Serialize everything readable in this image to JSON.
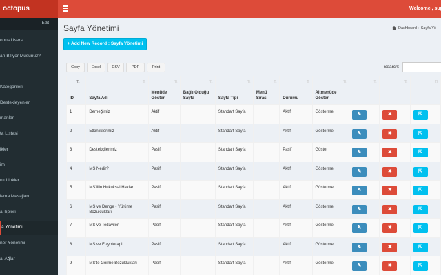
{
  "app": {
    "logo": "octopus",
    "welcome": "Welcome , super"
  },
  "sidebar": {
    "edit_label": "Edit",
    "items": [
      {
        "label": "opus Users"
      },
      {
        "label": "arı Biliyor Musunuz?"
      },
      {
        "label": "Kategorileri"
      },
      {
        "label": "Destekleyenler"
      },
      {
        "label": "manlar"
      },
      {
        "label": "ta Listesi"
      },
      {
        "label": "ikler"
      },
      {
        "label": "im"
      },
      {
        "label": "nlı Linkler"
      },
      {
        "label": "lama Mesajları"
      },
      {
        "label": "a Tipleri"
      },
      {
        "label": "a Yönetimi"
      },
      {
        "label": "ner Yönetimi"
      },
      {
        "label": "al Ağlar"
      }
    ]
  },
  "page": {
    "title": "Sayfa Yönetimi",
    "breadcrumb": {
      "home": "Dashboard",
      "current": "Sayfa Yö"
    },
    "add_button": "+ Add New Record : Sayfa Yönetimi"
  },
  "toolbar": {
    "buttons": [
      "Copy",
      "Excel",
      "CSV",
      "PDF",
      "Print"
    ],
    "search_label": "Search:",
    "search_value": ""
  },
  "table": {
    "headers": [
      "ID",
      "Sayfa Adı",
      "Menüde Göster",
      "Bağlı Olduğu Sayfa",
      "Sayfa Tipi",
      "Menü Sırası",
      "Durumu",
      "Altmenüde Göster",
      "",
      "",
      ""
    ],
    "rows": [
      {
        "id": "1",
        "name": "Derneğimiz",
        "menu": "Aktif",
        "parent": "",
        "type": "Standart Sayfa",
        "order": "",
        "status": "Aktif",
        "submenu": "Gösterme"
      },
      {
        "id": "2",
        "name": "Etkinliklerimiz",
        "menu": "Aktif",
        "parent": "",
        "type": "Standart Sayfa",
        "order": "",
        "status": "Aktif",
        "submenu": "Gösterme"
      },
      {
        "id": "3",
        "name": "Destekçilerimiz",
        "menu": "Pasif",
        "parent": "",
        "type": "Standart Sayfa",
        "order": "",
        "status": "Pasif",
        "submenu": "Göster"
      },
      {
        "id": "4",
        "name": "MS Nedir?",
        "menu": "Pasif",
        "parent": "",
        "type": "Standart Sayfa",
        "order": "",
        "status": "Aktif",
        "submenu": "Gösterme"
      },
      {
        "id": "5",
        "name": "MS'lilin Hukuksal Hakları",
        "menu": "Pasif",
        "parent": "",
        "type": "Standart Sayfa",
        "order": "",
        "status": "Aktif",
        "submenu": "Gösterme"
      },
      {
        "id": "6",
        "name": "MS ve Denge - Yürüme Bozuklukları",
        "menu": "Pasif",
        "parent": "",
        "type": "Standart Sayfa",
        "order": "",
        "status": "Aktif",
        "submenu": "Gösterme"
      },
      {
        "id": "7",
        "name": "MS ve Tedaviler",
        "menu": "Pasif",
        "parent": "",
        "type": "Standart Sayfa",
        "order": "",
        "status": "Aktif",
        "submenu": "Gösterme"
      },
      {
        "id": "8",
        "name": "MS ve Fizyoterapi",
        "menu": "Pasif",
        "parent": "",
        "type": "Standart Sayfa",
        "order": "",
        "status": "Aktif",
        "submenu": "Gösterme"
      },
      {
        "id": "9",
        "name": "MS'te Görme Bozuklukları",
        "menu": "Pasif",
        "parent": "",
        "type": "Standart Sayfa",
        "order": "",
        "status": "Aktif",
        "submenu": "Gösterme"
      }
    ]
  },
  "icons": {
    "edit": "edit-icon",
    "delete": "delete-icon",
    "open": "external-link-icon",
    "menu": "hamburger-icon",
    "home": "dashboard-icon"
  },
  "colors": {
    "header": "#dd4b39",
    "logo_bg": "#c23321",
    "sidebar": "#222d32",
    "primary": "#3c8dbc",
    "danger": "#dd4b39",
    "info": "#00c0ef"
  }
}
